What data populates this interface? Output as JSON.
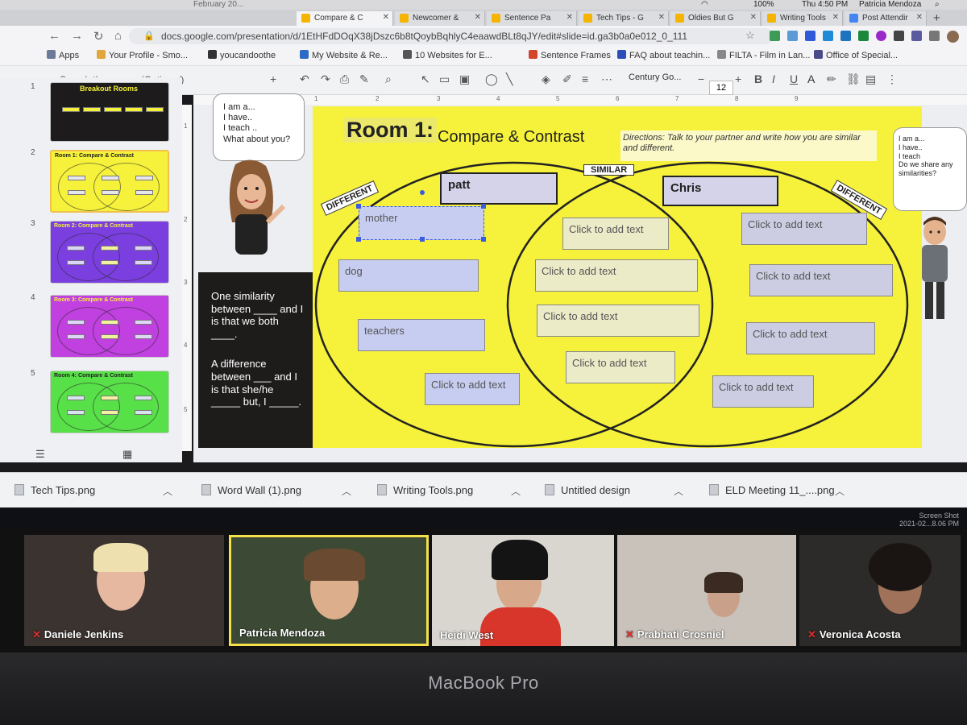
{
  "menubar": {
    "battery": "100%",
    "clock": "Thu 4:50 PM",
    "user": "Patricia Mendoza",
    "partial_tab": "February 20..."
  },
  "tabs": [
    {
      "label": "Compare & C",
      "active": true
    },
    {
      "label": "Newcomer &"
    },
    {
      "label": "Sentence Pa"
    },
    {
      "label": "Tech Tips - G"
    },
    {
      "label": "Oldies But G"
    },
    {
      "label": "Writing Tools"
    },
    {
      "label": "Post Attendir"
    }
  ],
  "address": {
    "url": "docs.google.com/presentation/d/1EtHFdDOqX38jDszc6b8tQoybBqhlyC4eaawdBLt8qJY/edit#slide=id.ga3b0a0e012_0_111"
  },
  "bookmarks": [
    "Apps",
    "Your Profile - Smo...",
    "youcandoothe",
    "My Website & Re...",
    "10 Websites for E...",
    "Sentence Frames",
    "FAQ about teachin...",
    "FILTA - Film in Lan...",
    "Office of Special..."
  ],
  "toolbar": {
    "menu_search": "Search the menus (Option+/)",
    "font": "Century Go...",
    "font_size": "12"
  },
  "ruler": [
    "1",
    "2",
    "3",
    "4",
    "5",
    "6",
    "7",
    "8",
    "9"
  ],
  "vruler": [
    "1",
    "2",
    "3",
    "4",
    "5"
  ],
  "slides": [
    {
      "num": "1",
      "title": "Breakout Rooms",
      "color": "#1d1b1b"
    },
    {
      "num": "2",
      "title": "Room 1: Compare & Contrast",
      "color": "#f6f23b"
    },
    {
      "num": "3",
      "title": "Room 2: Compare & Contrast",
      "color": "#7b3fe0"
    },
    {
      "num": "4",
      "title": "Room 3: Compare & Contrast",
      "color": "#c040e0"
    },
    {
      "num": "5",
      "title": "Room 4: Compare & Contrast",
      "color": "#58e048"
    }
  ],
  "slide": {
    "title_bold": "Room 1:",
    "title_rest": "Compare & Contrast",
    "directions": "Directions: Talk to your partner and write how you are similar and different.",
    "tag_different_left": "DIFFERENT",
    "tag_similar": "SIMILAR",
    "tag_different_right": "DIFFERENT",
    "name_left": "patt",
    "name_right": "Chris",
    "left_boxes": [
      "mother",
      "dog",
      "teachers",
      "Click to add text"
    ],
    "middle_boxes": [
      "Click to add text",
      "Click to add text",
      "Click to add text",
      "Click to add text"
    ],
    "right_boxes": [
      "Click to add text",
      "Click to add text",
      "Click to add text",
      "Click to add text"
    ],
    "bubble_left": [
      "I am a...",
      "I have..",
      "I teach ..",
      "What about you?"
    ],
    "bubble_right": [
      "I am a...",
      "I have..",
      "I teach",
      "Do we share any similarities?"
    ],
    "sentence_1": "One similarity between ____ and I is that we both ____.",
    "sentence_2": "A difference between ___ and I is that she/he _____ but, I _____."
  },
  "downloads": [
    "Tech Tips.png",
    "Word Wall (1).png",
    "Writing Tools.png",
    "Untitled design",
    "ELD Meeting 11_....png"
  ],
  "zoom": {
    "screenshot_label": "Screen Shot",
    "screenshot_time": "2021-02...8.06 PM"
  },
  "participants": [
    {
      "name": "Daniele Jenkins",
      "muted": true,
      "bg": "#3a3330"
    },
    {
      "name": "Patricia Mendoza",
      "muted": false,
      "active": true,
      "bg": "#3c4a35"
    },
    {
      "name": "Heidi West",
      "muted": false,
      "bg": "#d9d6d0"
    },
    {
      "name": "Prabhati Crosniel",
      "muted": true,
      "bg": "#c8c2bb"
    },
    {
      "name": "Veronica Acosta",
      "muted": true,
      "bg": "#2c2b2a"
    }
  ],
  "bezel": {
    "brand": "MacBook Pro"
  },
  "colors": {
    "slide_yellow": "#f6f23b",
    "zoom_active": "#f3e04a",
    "selection_blue": "#3b5be0"
  }
}
